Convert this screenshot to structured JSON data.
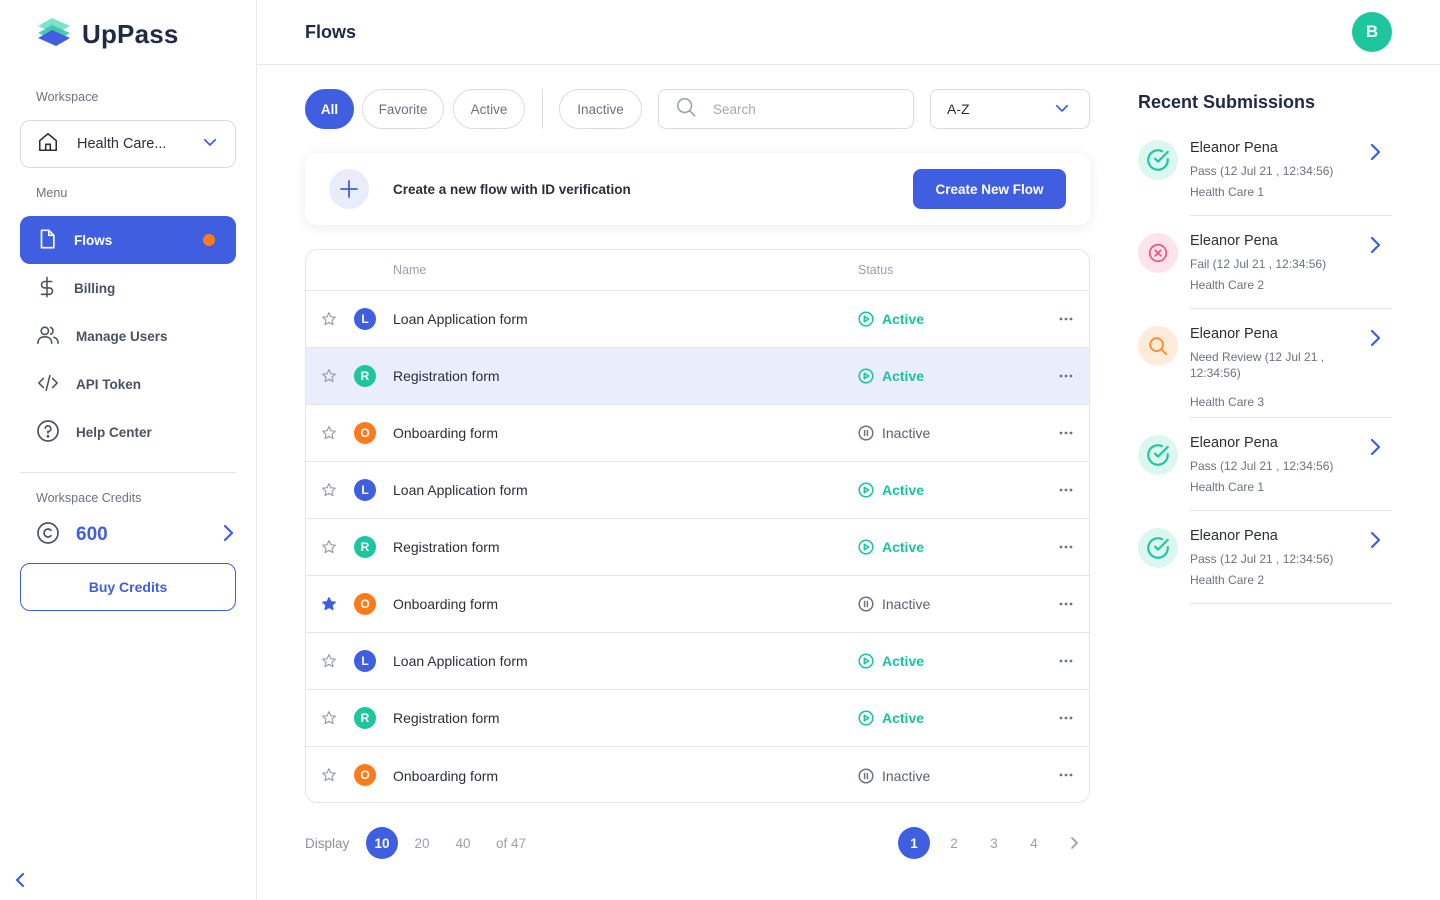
{
  "brand": {
    "name": "UpPass"
  },
  "sidebar": {
    "workspace_label": "Workspace",
    "workspace_name": "Health Care...",
    "menu_label": "Menu",
    "items": [
      {
        "label": "Flows",
        "icon": "file-icon",
        "active": true,
        "notification_dot": true
      },
      {
        "label": "Billing",
        "icon": "dollar-icon"
      },
      {
        "label": "Manage Users",
        "icon": "users-icon"
      },
      {
        "label": "API Token",
        "icon": "code-icon"
      },
      {
        "label": "Help Center",
        "icon": "help-icon"
      }
    ],
    "credits_label": "Workspace Credits",
    "credits_value": "600",
    "buy_label": "Buy Credits"
  },
  "header": {
    "title": "Flows",
    "avatar_initial": "B"
  },
  "filters": {
    "chips": [
      "All",
      "Favorite",
      "Active",
      "Inactive"
    ],
    "active_chip": "All",
    "search_placeholder": "Search",
    "sort_value": "A-Z"
  },
  "create": {
    "text": "Create a new flow with ID verification",
    "button": "Create New Flow"
  },
  "table": {
    "columns": [
      "Name",
      "Status"
    ],
    "rows": [
      {
        "badge": "L",
        "name": "Loan Application form",
        "status": "Active",
        "favorite": false
      },
      {
        "badge": "R",
        "name": "Registration  form",
        "status": "Active",
        "favorite": false
      },
      {
        "badge": "O",
        "name": "Onboarding form",
        "status": "Inactive",
        "favorite": false
      },
      {
        "badge": "L",
        "name": "Loan Application form",
        "status": "Active",
        "favorite": false
      },
      {
        "badge": "R",
        "name": "Registration  form",
        "status": "Active",
        "favorite": false
      },
      {
        "badge": "O",
        "name": "Onboarding form",
        "status": "Inactive",
        "favorite": true
      },
      {
        "badge": "L",
        "name": "Loan Application form",
        "status": "Active",
        "favorite": false
      },
      {
        "badge": "R",
        "name": "Registration  form",
        "status": "Active",
        "favorite": false
      },
      {
        "badge": "O",
        "name": "Onboarding form",
        "status": "Inactive",
        "favorite": false
      }
    ]
  },
  "pagination": {
    "display_label": "Display",
    "sizes": [
      "10",
      "20",
      "40"
    ],
    "active_size": "10",
    "of_total": "of 47",
    "pages": [
      "1",
      "2",
      "3",
      "4"
    ],
    "current_page": "1"
  },
  "recent": {
    "title": "Recent Submissions",
    "items": [
      {
        "name": "Eleanor Pena",
        "status": "Pass (12 Jul 21 , 12:34:56)",
        "workspace": "Health Care 1",
        "type": "pass"
      },
      {
        "name": "Eleanor Pena",
        "status": "Fail (12 Jul 21 , 12:34:56)",
        "workspace": "Health Care 2",
        "type": "fail"
      },
      {
        "name": "Eleanor Pena",
        "status": "Need Review (12 Jul 21 , 12:34:56)",
        "workspace": "Health Care 3",
        "type": "review"
      },
      {
        "name": "Eleanor Pena",
        "status": "Pass (12 Jul 21 , 12:34:56)",
        "workspace": "Health Care 1",
        "type": "pass"
      },
      {
        "name": "Eleanor Pena",
        "status": "Pass (12 Jul 21 , 12:34:56)",
        "workspace": "Health Care 2",
        "type": "pass"
      }
    ]
  },
  "colors": {
    "accent": "#3f5fe0",
    "active_status": "#17c4a0",
    "badge_L": "#3f5fe0",
    "badge_R": "#1ec6a0",
    "badge_O": "#ff7a1a",
    "notification": "#ff7a1a",
    "pass": "#1ec6a0",
    "fail": "#f0507a",
    "review": "#ff8a2a"
  }
}
